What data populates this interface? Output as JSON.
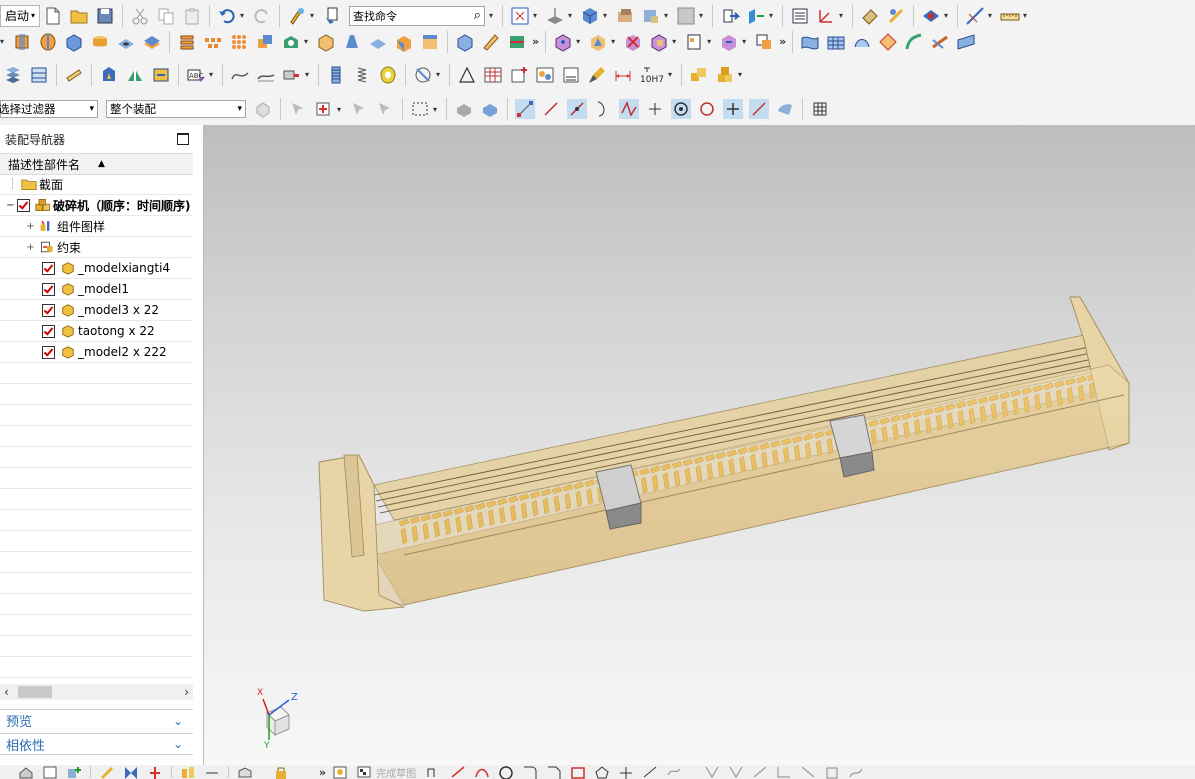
{
  "toolbar": {
    "start_label": "启动",
    "search_placeholder": "查找命令",
    "filter_combo": "选择过滤器",
    "assembly_combo": "整个装配",
    "tolerance_label": "10H7"
  },
  "navigator": {
    "title": "装配导航器",
    "column_header": "描述性部件名",
    "items": [
      {
        "label": "截面",
        "level": 0,
        "expander": "",
        "checked": false,
        "icon": "folder-icon"
      },
      {
        "label": "破碎机（顺序：时间顺序)",
        "level": 0,
        "expander": "−",
        "checked": true,
        "icon": "assembly-icon"
      },
      {
        "label": "组件图样",
        "level": 1,
        "expander": "+",
        "checked": false,
        "icon": "component-pattern-icon"
      },
      {
        "label": "约束",
        "level": 1,
        "expander": "+",
        "checked": false,
        "icon": "constraints-icon"
      },
      {
        "label": "_modelxiangti4",
        "level": 2,
        "expander": "",
        "checked": true,
        "icon": "part-icon"
      },
      {
        "label": "_model1",
        "level": 2,
        "expander": "",
        "checked": true,
        "icon": "part-icon"
      },
      {
        "label": "_model3 x 22",
        "level": 2,
        "expander": "",
        "checked": true,
        "icon": "part-icon"
      },
      {
        "label": "taotong x 22",
        "level": 2,
        "expander": "",
        "checked": true,
        "icon": "part-icon"
      },
      {
        "label": "_model2 x 222",
        "level": 2,
        "expander": "",
        "checked": true,
        "icon": "part-icon"
      }
    ],
    "preview_label": "预览",
    "dependency_label": "相依性"
  },
  "triad": {
    "x": "X",
    "y": "Y",
    "z": "Z"
  },
  "bottom": {
    "sketch_label": "完成草图"
  },
  "colors": {
    "accent": "#2b6cb3",
    "housing": "#e8d3a4",
    "gear": "#f0a814",
    "block": "#c4c4c4"
  }
}
